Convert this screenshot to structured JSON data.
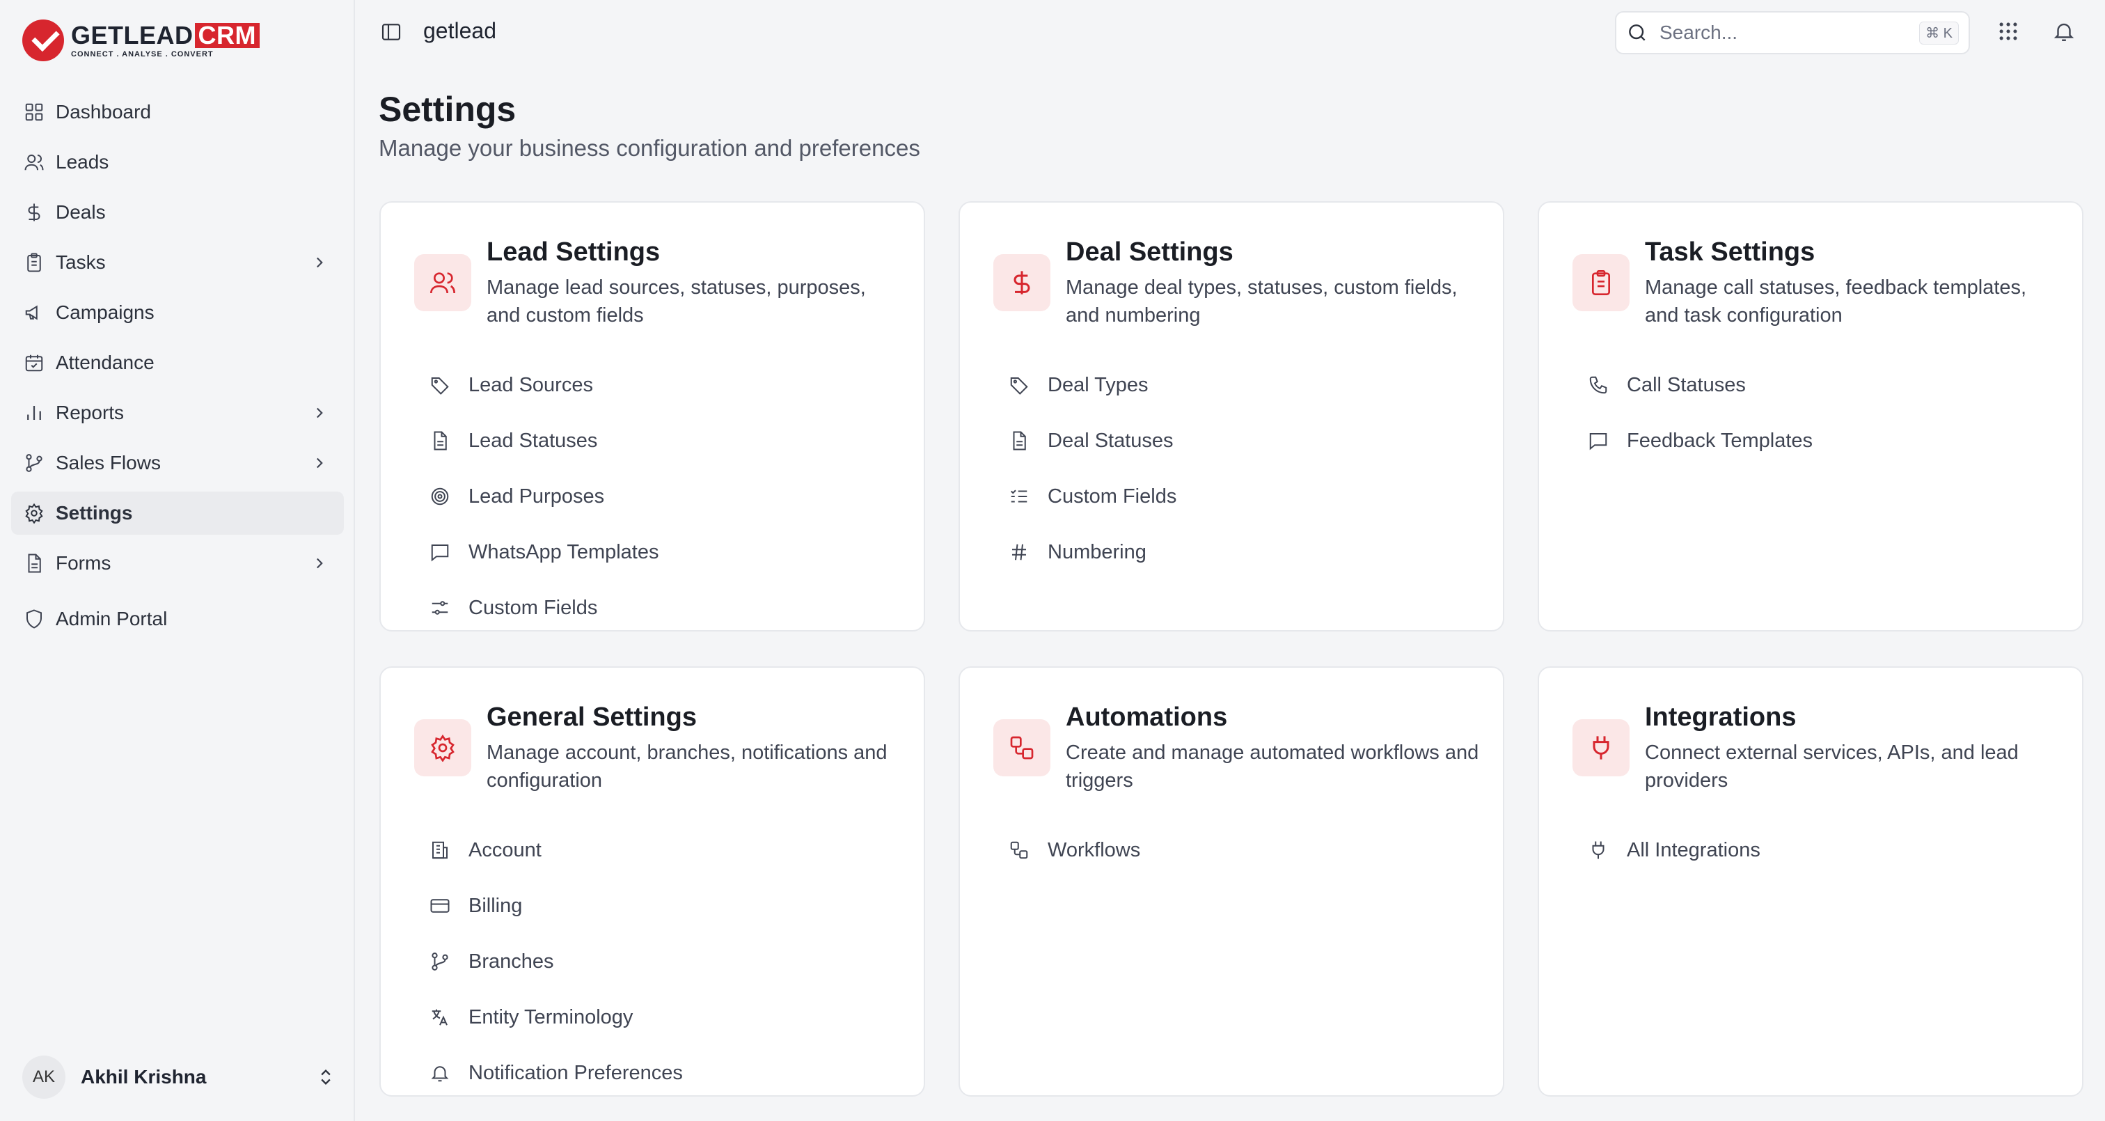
{
  "brand": {
    "name": "GETLEAD",
    "crm": "CRM",
    "tagline": "CONNECT  .  ANALYSE  .  CONVERT"
  },
  "sidebar": {
    "items": [
      {
        "label": "Dashboard"
      },
      {
        "label": "Leads"
      },
      {
        "label": "Deals"
      },
      {
        "label": "Tasks"
      },
      {
        "label": "Campaigns"
      },
      {
        "label": "Attendance"
      },
      {
        "label": "Reports"
      },
      {
        "label": "Sales Flows"
      },
      {
        "label": "Settings"
      },
      {
        "label": "Forms"
      },
      {
        "label": "Admin Portal"
      }
    ],
    "active": "Settings"
  },
  "user": {
    "initials": "AK",
    "name": "Akhil Krishna"
  },
  "header": {
    "workspace": "getlead",
    "search_placeholder": "Search...",
    "search_shortcut": "⌘ K"
  },
  "page": {
    "title": "Settings",
    "subtitle": "Manage your business configuration and preferences"
  },
  "cards": [
    {
      "title": "Lead Settings",
      "desc": "Manage lead sources, statuses, purposes, and custom fields",
      "links": [
        "Lead Sources",
        "Lead Statuses",
        "Lead Purposes",
        "WhatsApp Templates",
        "Custom Fields"
      ]
    },
    {
      "title": "Deal Settings",
      "desc": "Manage deal types, statuses, custom fields, and numbering",
      "links": [
        "Deal Types",
        "Deal Statuses",
        "Custom Fields",
        "Numbering"
      ]
    },
    {
      "title": "Task Settings",
      "desc": "Manage call statuses, feedback templates, and task configuration",
      "links": [
        "Call Statuses",
        "Feedback Templates"
      ]
    },
    {
      "title": "General Settings",
      "desc": "Manage account, branches, notifications and configuration",
      "links": [
        "Account",
        "Billing",
        "Branches",
        "Entity Terminology",
        "Notification Preferences"
      ]
    },
    {
      "title": "Automations",
      "desc": "Create and manage automated workflows and triggers",
      "links": [
        "Workflows"
      ]
    },
    {
      "title": "Integrations",
      "desc": "Connect external services, APIs, and lead providers",
      "links": [
        "All Integrations"
      ]
    }
  ],
  "colors": {
    "accent": "#d7262e",
    "icon_bg": "#fbe7e7",
    "active_nav": "#eaebee"
  }
}
